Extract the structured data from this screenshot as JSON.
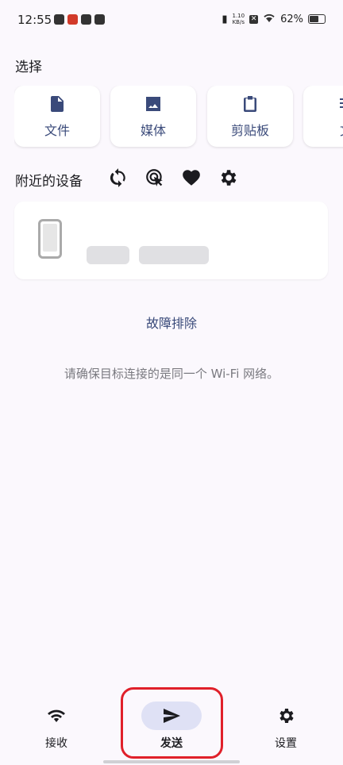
{
  "status_bar": {
    "time": "12:55",
    "net_speed": "1.10\nKB/s",
    "battery": "62%"
  },
  "select": {
    "title": "选择",
    "items": [
      {
        "label": "文件",
        "icon": "file-icon"
      },
      {
        "label": "媒体",
        "icon": "image-icon"
      },
      {
        "label": "剪贴板",
        "icon": "clipboard-icon"
      },
      {
        "label": "文",
        "icon": "text-icon"
      }
    ]
  },
  "nearby": {
    "title": "附近的设备",
    "actions": [
      "refresh-icon",
      "target-click-icon",
      "heart-icon",
      "gear-icon"
    ]
  },
  "troubleshoot": "故障排除",
  "hint": "请确保目标连接的是同一个 Wi-Fi 网络。",
  "bottom_nav": {
    "receive": "接收",
    "send": "发送",
    "settings": "设置"
  },
  "colors": {
    "accent": "#3a4a7a",
    "active_pill": "#dfe1f5",
    "highlight": "#e0202a",
    "background": "#fbf8fd"
  }
}
